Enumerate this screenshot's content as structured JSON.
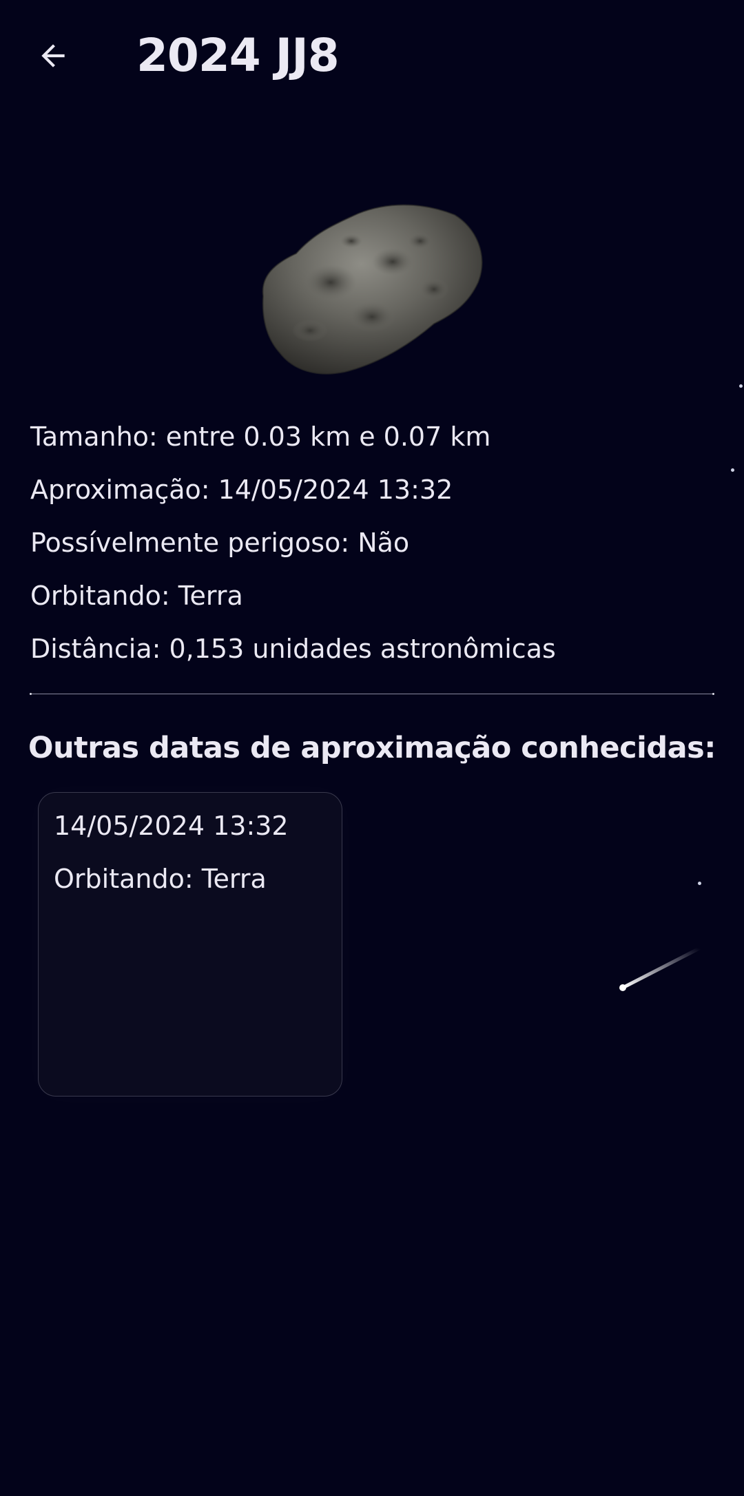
{
  "header": {
    "title": "2024 JJ8",
    "back_icon": "arrow-back-icon"
  },
  "asteroid": {
    "icon": "asteroid-image",
    "color": "#6b6a63"
  },
  "details": {
    "size": "Tamanho: entre 0.03 km e 0.07 km",
    "approach": "Aproximação: 14/05/2024 13:32",
    "hazardous": "Possívelmente perigoso: Não",
    "orbiting": "Orbitando: Terra",
    "distance": "Distância: 0,153 unidades astronômicas"
  },
  "other_dates": {
    "title": "Outras datas de aproximação conhecidas:",
    "cards": [
      {
        "date": "14/05/2024 13:32",
        "orbiting": "Orbitando: Terra"
      }
    ]
  },
  "colors": {
    "background": "#03031a",
    "text": "#ebe9f3",
    "card_background": "#0b0b1f",
    "card_border": "#3a3a4e"
  }
}
